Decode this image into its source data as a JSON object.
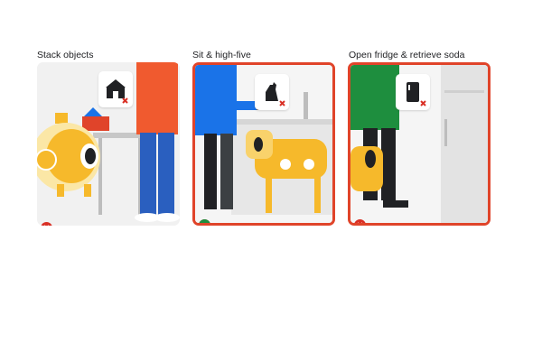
{
  "panels": [
    {
      "title": "Stack objects",
      "selected": false,
      "task_icon": "house-blocks-icon",
      "outcomes": [
        "fail-icon"
      ]
    },
    {
      "title": "Sit & high-five",
      "selected": true,
      "task_icon": "dog-sit-icon",
      "outcomes": [
        "fail-icon",
        "success-icon"
      ]
    },
    {
      "title": "Open fridge & retrieve soda",
      "selected": true,
      "task_icon": "fridge-icon",
      "outcomes": [
        "fail-icon"
      ]
    }
  ],
  "colors": {
    "selected_border": "#e0442a",
    "fail": "#d93025",
    "success": "#1e8e3e",
    "robot_yellow": "#f6b92b"
  }
}
